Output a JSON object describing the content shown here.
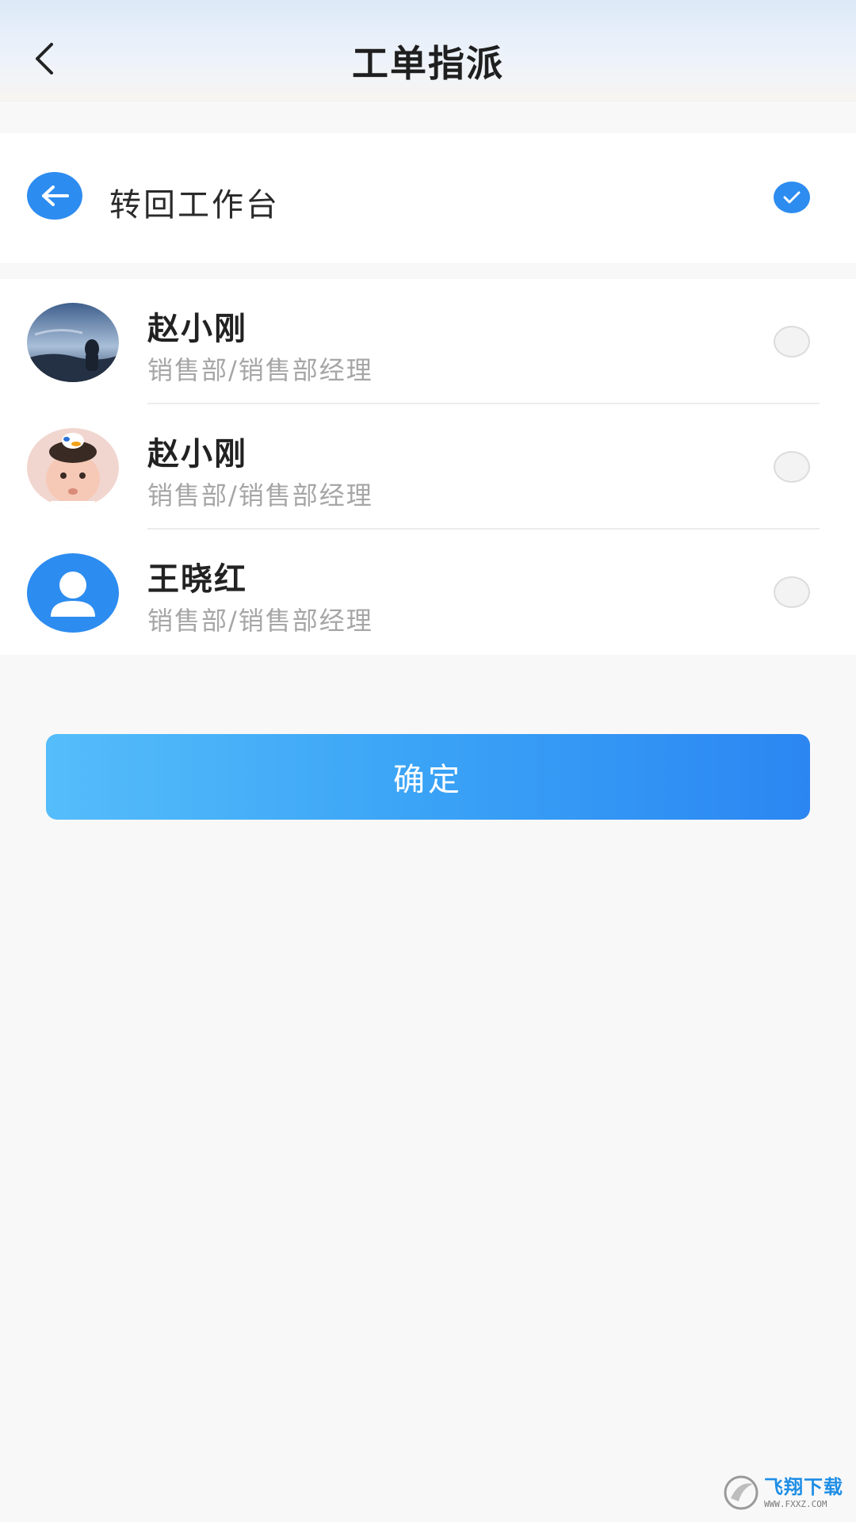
{
  "header": {
    "title": "工单指派"
  },
  "workbench": {
    "label": "转回工作台",
    "checked": true
  },
  "staff": [
    {
      "name": "赵小刚",
      "dept": "销售部/销售部经理",
      "avatar": "photo-landscape",
      "checked": false
    },
    {
      "name": "赵小刚",
      "dept": "销售部/销售部经理",
      "avatar": "photo-baby",
      "checked": false
    },
    {
      "name": "王晓红",
      "dept": "销售部/销售部经理",
      "avatar": "default-user-icon",
      "checked": false
    }
  ],
  "confirm": {
    "label": "确定"
  },
  "watermark": {
    "text": "飞翔下载",
    "url": "WWW.FXXZ.COM"
  },
  "colors": {
    "accent": "#2d8cf0",
    "button_gradient_start": "#55bdfa",
    "button_gradient_end": "#2b86f2"
  }
}
